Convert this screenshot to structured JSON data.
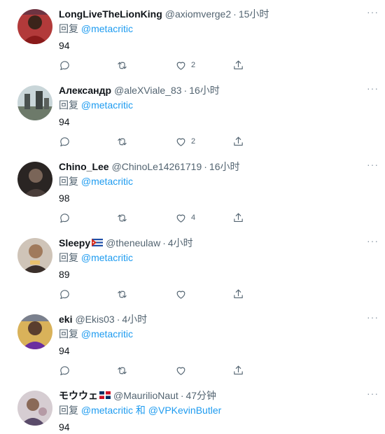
{
  "tweets": [
    {
      "name": "LongLiveTheLionKing",
      "handle": "@axiomverge2",
      "separator": "·",
      "time": "15小时",
      "reply_prefix": "回复",
      "mentions": [
        "@metacritic"
      ],
      "text": "94",
      "like_count": "2",
      "avatar_color": "#8a1a1a"
    },
    {
      "name": "Александр",
      "handle": "@aleXViale_83",
      "separator": "·",
      "time": "16小时",
      "reply_prefix": "回复",
      "mentions": [
        "@metacritic"
      ],
      "text": "94",
      "like_count": "2",
      "avatar_color": "#5d6b70"
    },
    {
      "name": "Chino_Lee",
      "handle": "@ChinoLe14261719",
      "separator": "·",
      "time": "16小时",
      "reply_prefix": "回复",
      "mentions": [
        "@metacritic"
      ],
      "text": "98",
      "like_count": "4",
      "avatar_color": "#3a3230"
    },
    {
      "name": "Sleepy",
      "flag": "cuba-flag-icon",
      "handle": "@theneulaw",
      "separator": "·",
      "time": "4小时",
      "reply_prefix": "回复",
      "mentions": [
        "@metacritic"
      ],
      "text": "89",
      "like_count": "",
      "avatar_color": "#a07a5c"
    },
    {
      "name": "eki",
      "handle": "@Ekis03",
      "separator": "·",
      "time": "4小时",
      "reply_prefix": "回复",
      "mentions": [
        "@metacritic"
      ],
      "text": "94",
      "like_count": "",
      "avatar_color": "#b08a3c"
    },
    {
      "name": "モウウェ",
      "flag": "dominican-flag-icon",
      "handle": "@MaurilioNaut",
      "separator": "·",
      "time": "47分钟",
      "reply_prefix": "回复",
      "mentions": [
        "@metacritic",
        "@VPKevinButler"
      ],
      "mention_joiner": "和",
      "text": "94",
      "like_count": "",
      "avatar_color": "#8c7f8a"
    }
  ],
  "more_glyph": "···",
  "colors": {
    "link": "#1d9bf0",
    "secondary": "#536471",
    "primary": "#0f1419"
  }
}
